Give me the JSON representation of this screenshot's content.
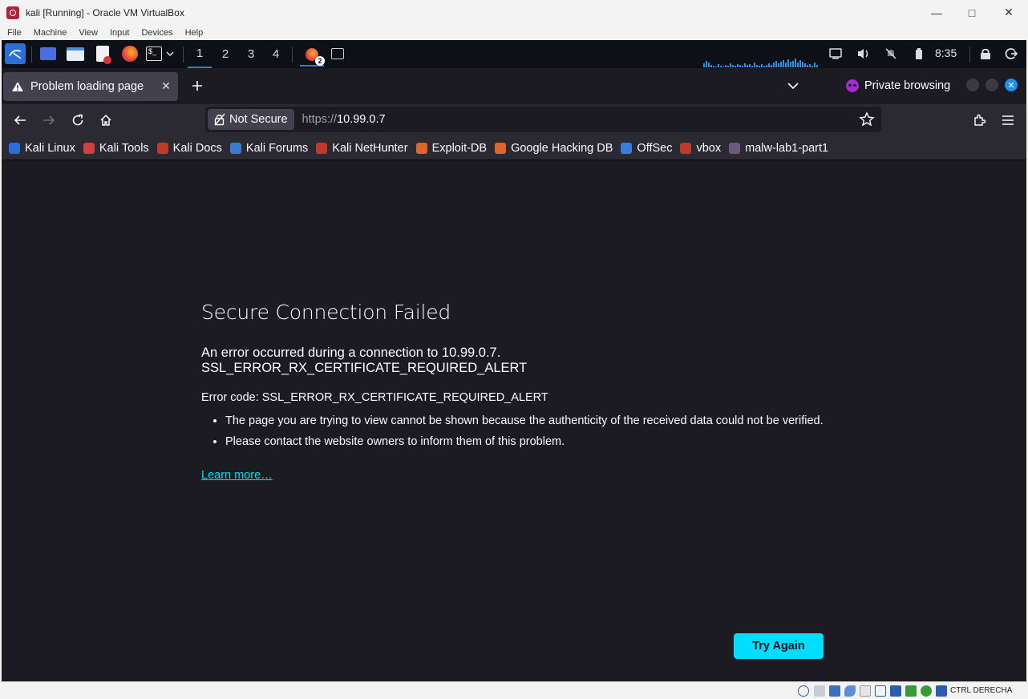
{
  "vbox": {
    "title": "kali [Running] - Oracle VM VirtualBox",
    "menu": [
      "File",
      "Machine",
      "View",
      "Input",
      "Devices",
      "Help"
    ],
    "host_key": "CTRL DERECHA"
  },
  "panel": {
    "workspaces": [
      "1",
      "2",
      "3",
      "4"
    ],
    "active_workspace": "1",
    "firefox_badge": "2",
    "clock": "8:35"
  },
  "browser": {
    "tab_title": "Problem loading page",
    "private_label": "Private browsing",
    "security_label": "Not Secure",
    "url_scheme": "https://",
    "url_host": "10.99.0.7",
    "bookmarks": [
      {
        "label": "Kali Linux",
        "color": "#2a6fd6"
      },
      {
        "label": "Kali Tools",
        "color": "#d14040"
      },
      {
        "label": "Kali Docs",
        "color": "#c0392b"
      },
      {
        "label": "Kali Forums",
        "color": "#3a7bd5"
      },
      {
        "label": "Kali NetHunter",
        "color": "#c0392b"
      },
      {
        "label": "Exploit-DB",
        "color": "#e0642a"
      },
      {
        "label": "Google Hacking DB",
        "color": "#e0642a"
      },
      {
        "label": "OffSec",
        "color": "#3b7ddd"
      },
      {
        "label": "vbox",
        "color": "#c0392b"
      },
      {
        "label": "malw-lab1-part1",
        "color": "#6b5a7a"
      }
    ]
  },
  "error_page": {
    "title": "Secure Connection Failed",
    "description": "An error occurred during a connection to 10.99.0.7. SSL_ERROR_RX_CERTIFICATE_REQUIRED_ALERT",
    "error_code": "Error code: SSL_ERROR_RX_CERTIFICATE_REQUIRED_ALERT",
    "bullets": [
      "The page you are trying to view cannot be shown because the authenticity of the received data could not be verified.",
      "Please contact the website owners to inform them of this problem."
    ],
    "learn_more": "Learn more…",
    "try_again": "Try Again"
  },
  "colors": {
    "accent": "#00ddff",
    "vm_background": "#1c1b22",
    "toolbar": "#2b2a33"
  }
}
